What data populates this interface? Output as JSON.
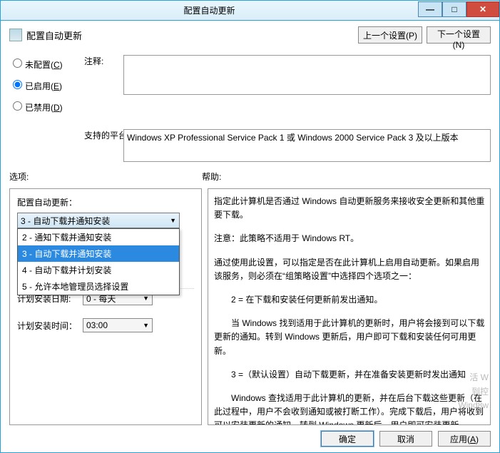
{
  "window": {
    "title": "配置自动更新"
  },
  "header": {
    "title": "配置自动更新",
    "prev_setting": "上一个设置(P)",
    "next_setting": "下一个设置(N)"
  },
  "radios": {
    "not_configured": "未配置(C)",
    "enabled": "已启用(E)",
    "disabled": "已禁用(D)",
    "selected": "enabled"
  },
  "labels": {
    "note": "注释:",
    "platform": "支持的平台:",
    "options": "选项:",
    "help": "帮助:"
  },
  "platform_text": "Windows XP Professional Service Pack 1 或 Windows 2000 Service Pack 3 及以上版本",
  "options": {
    "config_label": "配置自动更新：",
    "selected_value": "3 - 自动下载并通知安装",
    "dropdown": [
      "2 - 通知下载并通知安装",
      "3 - 自动下载并通知安装",
      "4 - 自动下载并计划安装",
      "5 - 允许本地管理员选择设置"
    ],
    "dropdown_selected_index": 1,
    "schedule_day_label": "计划安装日期:",
    "schedule_day_value": "0 - 每天",
    "schedule_time_label": "计划安装时间：",
    "schedule_time_value": "03:00"
  },
  "help": {
    "p1": "指定此计算机是否通过 Windows 自动更新服务来接收安全更新和其他重要下载。",
    "p2": "注意：此策略不适用于 Windows RT。",
    "p3": "通过使用此设置，可以指定是否在此计算机上启用自动更新。如果启用该服务，则必须在“组策略设置”中选择四个选项之一：",
    "p4": "2 = 在下载和安装任何更新前发出通知。",
    "p5": "当 Windows 找到适用于此计算机的更新时，用户将会接到可以下载更新的通知。转到 Windows 更新后，用户即可下载和安装任何可用更新。",
    "p6": "3 =（默认设置）自动下载更新，并在准备安装更新时发出通知",
    "p7": "Windows 查找适用于此计算机的更新，并在后台下载这些更新（在此过程中，用户不会收到通知或被打断工作）。完成下载后，用户将收到可以安装更新的通知。转到 Windows 更新后，用户即可安装更新。"
  },
  "footer": {
    "ok": "确定",
    "cancel": "取消",
    "apply": "应用(A)"
  },
  "win_controls": {
    "min": "—",
    "max": "□",
    "close": "✕"
  },
  "watermark": {
    "l1": "活 W",
    "l2": "到控",
    "l3": "Wind8w"
  }
}
